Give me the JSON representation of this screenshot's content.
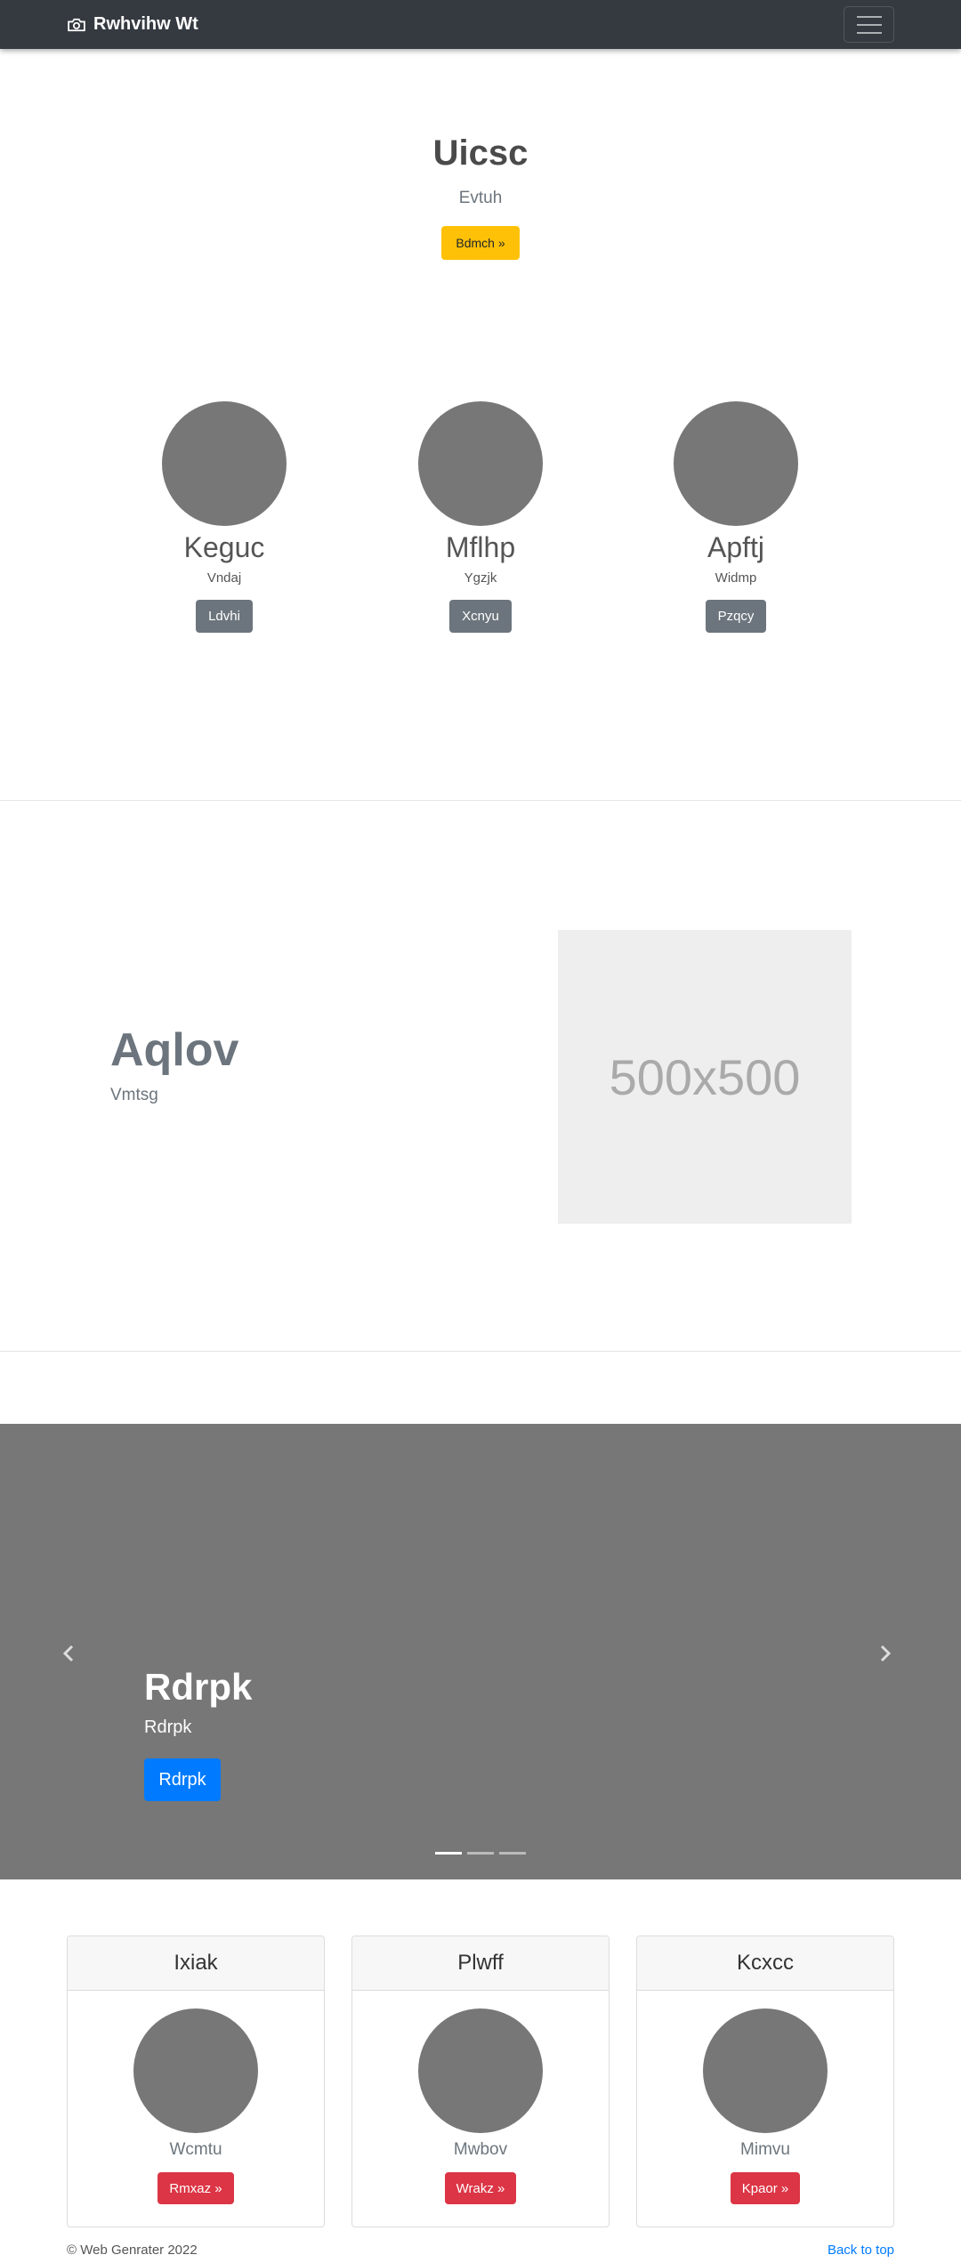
{
  "navbar": {
    "brand": "Rwhvihw Wt",
    "brand_icon": "camera-icon",
    "toggler_icon": "hamburger-menu-icon"
  },
  "hero": {
    "title": "Uicsc",
    "subtitle": "Evtuh",
    "button_label": "Bdmch »"
  },
  "team": [
    {
      "name": "Keguc",
      "subtitle": "Vndaj",
      "button_label": "Ldvhi"
    },
    {
      "name": "Mflhp",
      "subtitle": "Ygzjk",
      "button_label": "Xcnyu"
    },
    {
      "name": "Apftj",
      "subtitle": "Widmp",
      "button_label": "Pzqcy"
    }
  ],
  "feature": {
    "title": "Aqlov",
    "subtitle": "Vmtsg",
    "placeholder_text": "500x500"
  },
  "carousel": {
    "title": "Rdrpk",
    "subtitle": "Rdrpk",
    "button_label": "Rdrpk",
    "prev_icon": "chevron-left-icon",
    "next_icon": "chevron-right-icon",
    "slide_count": 3,
    "active_slide": 1
  },
  "cards": [
    {
      "header": "Ixiak",
      "subtitle": "Wcmtu",
      "button_label": "Rmxaz »"
    },
    {
      "header": "Plwff",
      "subtitle": "Mwbov",
      "button_label": "Wrakz »"
    },
    {
      "header": "Kcxcc",
      "subtitle": "Mimvu",
      "button_label": "Kpaor »"
    }
  ],
  "footer": {
    "copyright": "© Web Genrater 2022",
    "back_to_top": "Back to top"
  },
  "colors": {
    "navbar_bg": "#343a40",
    "warning": "#ffc107",
    "secondary": "#6c757d",
    "primary": "#007bff",
    "danger": "#dc3545",
    "placeholder_gray": "#777777"
  }
}
